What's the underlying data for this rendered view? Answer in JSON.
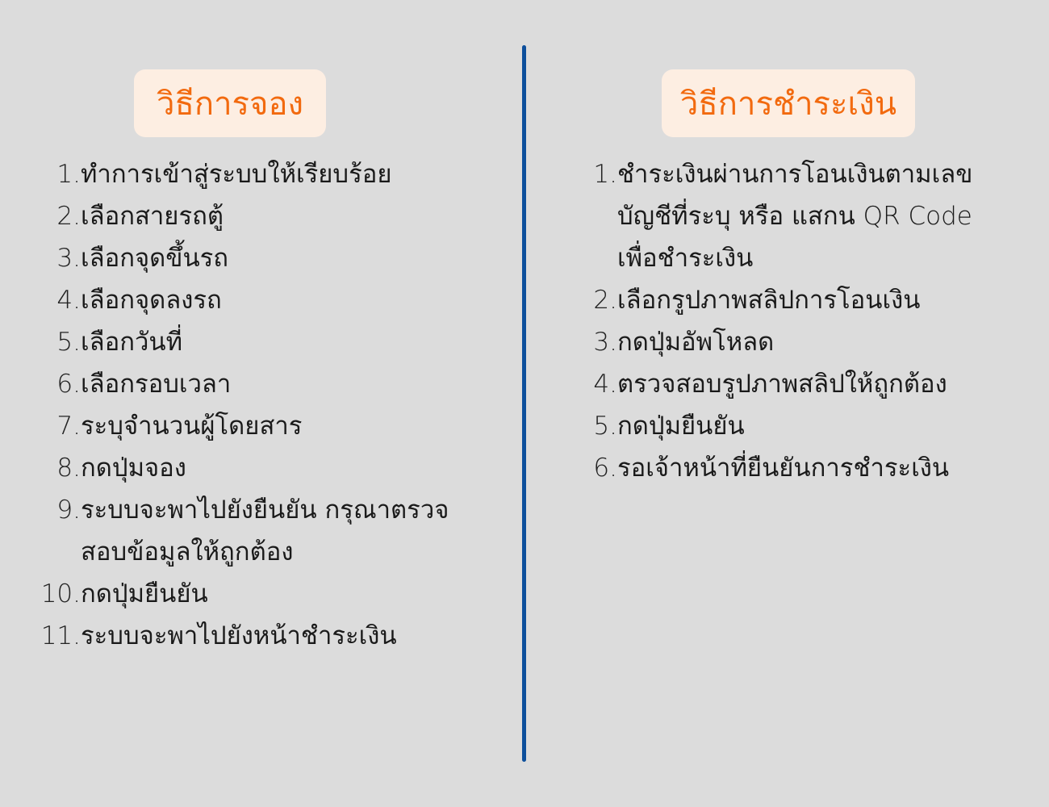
{
  "colors": {
    "background": "#dcdcdc",
    "title_bg": "#fdeee2",
    "title_text": "#f26a0f",
    "divider": "#0d4f9c",
    "body_text": "#1a1a1a"
  },
  "booking": {
    "title": "วิธีการจอง",
    "steps": [
      {
        "num": "1.",
        "text": "ทำการเข้าสู่ระบบให้เรียบร้อย"
      },
      {
        "num": "2.",
        "text": "เลือกสายรถตู้"
      },
      {
        "num": "3.",
        "text": "เลือกจุดขึ้นรถ"
      },
      {
        "num": "4.",
        "text": "เลือกจุดลงรถ"
      },
      {
        "num": "5.",
        "text": "เลือกวันที่"
      },
      {
        "num": "6.",
        "text": "เลือกรอบเวลา"
      },
      {
        "num": "7.",
        "text": "ระบุจำนวนผู้โดยสาร"
      },
      {
        "num": "8.",
        "text": "กดปุ่มจอง"
      },
      {
        "num": "9.",
        "text": "ระบบจะพาไปยังยืนยัน กรุณาตรวจสอบข้อมูลให้ถูกต้อง"
      },
      {
        "num": "10.",
        "text": "กดปุ่มยืนยัน"
      },
      {
        "num": "11.",
        "text": "ระบบจะพาไปยังหน้าชำระเงิน"
      }
    ]
  },
  "payment": {
    "title": "วิธีการชำระเงิน",
    "steps": [
      {
        "num": "1.",
        "text": "ชำระเงินผ่านการโอนเงินตามเลขบัญชีที่ระบุ หรือ แสกน",
        "text_light": " QR Code",
        "text_after": " เพื่อชำระเงิน"
      },
      {
        "num": "2.",
        "text": "เลือกรูปภาพสลิปการโอนเงิน"
      },
      {
        "num": "3.",
        "text": "กดปุ่มอัพโหลด"
      },
      {
        "num": "4.",
        "text": "ตรวจสอบรูปภาพสลิปให้ถูกต้อง"
      },
      {
        "num": "5.",
        "text": "กดปุ่มยืนยัน"
      },
      {
        "num": "6.",
        "text": "รอเจ้าหน้าที่ยืนยันการชำระเงิน"
      }
    ]
  }
}
